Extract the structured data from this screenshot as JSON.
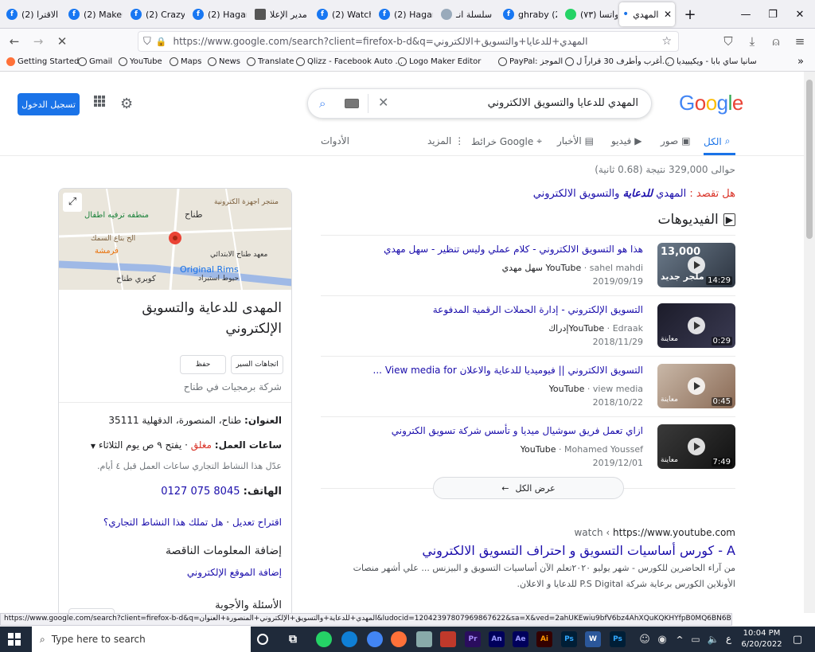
{
  "browser": {
    "tabs": [
      {
        "label": "(2) الاقترا"
      },
      {
        "label": "(2) Makeu"
      },
      {
        "label": "(2) Crazy"
      },
      {
        "label": "(2) Hagar"
      },
      {
        "label": "مدير الإعلا"
      },
      {
        "label": "(2) Watch"
      },
      {
        "label": "(2) Hagar"
      },
      {
        "label": "سلسلة انـ"
      },
      {
        "label": "ghraby (2)"
      },
      {
        "label": "(٧٣) واتسا"
      },
      {
        "label": "المهدي"
      }
    ],
    "url": "https://www.google.com/search?client=firefox-b-d&q=المهدي+للدعايا+والتسويق+الالكتروني",
    "bookmarks": [
      "Getting Started",
      "Gmail",
      "YouTube",
      "Maps",
      "News",
      "Translate",
      "Qlizz - Facebook Auto ...",
      "Logo Maker Editor",
      "PayPal: الموجز",
      "أغرب وأطرف 30 قراراً ل...",
      "سانيا ساي بابا - ويكيبيديا"
    ]
  },
  "google": {
    "logo": "Google",
    "query": "المهدي للدعايا والتسويق الالكتروني",
    "signin_label": "تسجيل الدخول",
    "tabs": {
      "all": "الكل",
      "images": "صور",
      "videos": "فيديو",
      "news": "الأخبار",
      "maps": "خرائط Google",
      "more": "المزيد",
      "tools": "الأدوات"
    },
    "result_stats": "حوالى 329,000 نتيجة (0.68 ثانية)",
    "did_you_mean": {
      "prefix": "هل تقصد :",
      "query_a": "المهدي",
      "query_b": "للدعاية",
      "query_c": "والتسويق الالكتروني"
    },
    "videos_heading": "الفيديوهات",
    "videos": [
      {
        "title": "هذا هو التسويق الالكتروني - كلام عملي وليس تنظير - سهل مهدي",
        "source": "YouTube",
        "channel": "sahel mahdi",
        "channel_ar": "سهل مهدي",
        "date": "2019/09/19",
        "duration": "14:29",
        "thumb_text": "13,000",
        "thumb_sub": "ملجر جديد"
      },
      {
        "title": "التسويق الإلكتروني - إدارة الحملات الرقمية المدفوعة",
        "source": "YouTube",
        "channel": "Edraak",
        "channel_ar": "إدراك",
        "date": "2018/11/29",
        "duration": "0:29",
        "thumb_sub": "معاينة"
      },
      {
        "title": "التسويق الالكتروني || فيوميديا للدعاية والاعلان View media for ...",
        "source": "YouTube",
        "channel": "view media",
        "date": "2018/10/22",
        "duration": "0:45",
        "thumb_sub": "معاينة"
      },
      {
        "title": "ازاي تعمل فريق سوشيال ميديا و تأسس شركة تسويق الكتروني",
        "source": "YouTube",
        "channel": "Mohamed Youssef",
        "date": "2019/12/01",
        "duration": "7:49",
        "thumb_sub": "معاينة"
      }
    ],
    "view_all": "عرض الكل",
    "result": {
      "breadcrumb": "https://www.youtube.com",
      "breadcrumb_suffix": "watch ‹",
      "title": "A - كورس أساسيات التسويق و احتراف التسويق الالكتروني",
      "snippet_1": "من آراء الحاضرين للكورس - شهر يوليو ٢٠٢٠تعلم الآن أساسيات التسويق و البيزنس ... علي أشهر منصات",
      "snippet_2": "الأونلاين الكورس برعاية شركة P.S Digital للدعايا و الاعلان."
    },
    "knowledge_panel": {
      "map_labels": [
        "منتجر اجهزة الكترونية",
        "طناح",
        "منطفه ترفيه اطفال",
        "الح بتاع السمك",
        "فرمشة",
        "معهد طناح الابتدائي",
        "Original Rims",
        "حيوط استبراد",
        "كوبري طناح"
      ],
      "title_line1": "المهدى للدعاية والتسويق",
      "title_line2": "الإلكتروني",
      "btn_directions": "اتجاهات السير",
      "btn_save": "حفظ",
      "category": "شركة برمجيات في طناح",
      "address_label": "العنوان:",
      "address": "طناح، المنصورة، الدقهلية 35111",
      "hours_label": "ساعات العمل:",
      "hours_status": "مغلق",
      "hours_text": "· يفتح ٩ ص يوم الثلاثاء",
      "hours_note": "عدّل هذا النشاط التجاري ساعات العمل قبل ٤ أيام.",
      "phone_label": "الهاتف:",
      "phone": "0127 075 8045",
      "suggest_edit": "اقتراح تعديل",
      "own_business": "هل تملك هذا النشاط التجاري؟",
      "missing_info": "إضافة المعلومات الناقصة",
      "add_website": "إضافة الموقع الإلكتروني",
      "qa": "الأسئلة والأجوبة"
    }
  },
  "status_bar": "https://www.google.com/search?client=firefox-b-d&q=المهدي+للدعاية+والتسويق+الإلكتروني+المنصورة+العنوان&ludocid=12042397807969867622&sa=X&ved=2ahUKEwiu9bfV6bz4AhXQuKQKHYfpB0MQ6BN6BAhVEAI",
  "taskbar": {
    "search_placeholder": "Type here to search",
    "time": "10:04 PM",
    "date": "6/20/2022",
    "lang": "ع"
  },
  "colors": {
    "accent": "#1a73e8",
    "link": "#1a0dab",
    "closed": "#d93025",
    "taskbar": "#1f2a3a"
  }
}
